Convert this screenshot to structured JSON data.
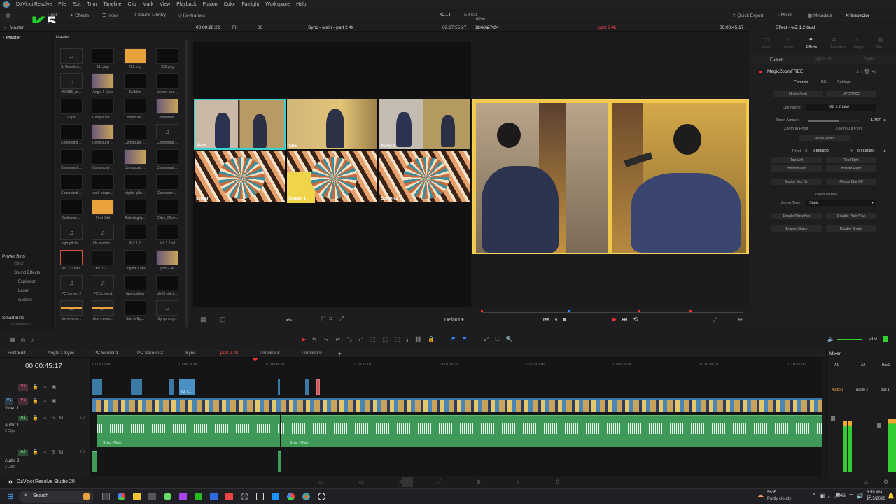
{
  "menu": [
    "DaVinci Resolve",
    "File",
    "Edit",
    "Trim",
    "Timeline",
    "Clip",
    "Mark",
    "View",
    "Playback",
    "Fusion",
    "Color",
    "Fairlight",
    "Workspace",
    "Help"
  ],
  "toolbar": {
    "media_pool": "Pool",
    "effects": "Effects",
    "index": "Index",
    "sound_library": "Sound Library",
    "keyframes": "Keyframes",
    "project": "#2...T",
    "project_status": "Edited",
    "quick_export": "Quick Export",
    "mixer": "Mixer",
    "metadata": "Metadata",
    "inspector": "Inspector"
  },
  "watermark": {
    "letter": "K",
    "number": "5"
  },
  "subbar": {
    "bin": "Master",
    "zoom_fit": "Fit",
    "fps_left": "30",
    "timecode_left": "00:00:28:22",
    "viewer_title": "Sync - Main - part 2 4k",
    "tc_mid": "02:27:55:27",
    "tc_dur": "01:00:57:04",
    "zoom": "62%",
    "fps_right": "30",
    "timeline_name": "part 2 4k",
    "timecode_right": "00:00:45:17"
  },
  "bins": {
    "master": "Master",
    "power_bins": "Power Bins",
    "power_items": [
      "Glitch",
      "Sound Effects",
      "Explosion",
      "Laser",
      "sudden"
    ],
    "smart_bins": "Smart Bins",
    "smart_items": [
      "Collections"
    ]
  },
  "media_clips": [
    "S. Gavattes...",
    "111.png",
    "222.png",
    "333.png",
    "055685_mi...",
    "Angle 1 Sync",
    "Sudden",
    "censor-bee...",
    "Clips",
    "Compound ...",
    "Compound ...",
    "Compound ...",
    "Compound ...",
    "Compound ...",
    "Compound ...",
    "Compound ...",
    "Compound ...",
    "Compound ...",
    "Compound ...",
    "Compound ...",
    "Compound ...",
    "dark-suspe...",
    "digital-glitc...",
    "Explosion ...",
    "Explosion ...",
    "First Edit",
    "flickeringlig...",
    "Glitch_05.m...",
    "high-pitche...",
    "kfs-motivin...",
    "MZ 1.2",
    "MZ 1.2 all",
    "MZ 1.2 talal",
    "MZ 1.2 ...",
    "Original Clips",
    "part 2 4k",
    "PC Screen 2",
    "PC Screen1",
    "fast sudden",
    "sfx20 glitch...",
    "sfx-reverse...",
    "slow-cinem...",
    "Sub in Ep...",
    "Symphony..."
  ],
  "source_tiles": [
    "Main",
    "Talal",
    "Turky 2",
    "screan",
    "Screen 1",
    "Screen 2"
  ],
  "viewer_controls": {
    "default": "Default"
  },
  "inspector": {
    "title": "Effect - MZ 1.2 talal",
    "tabs": [
      "Video",
      "Audio",
      "Effects",
      "Transition",
      "Image",
      "File"
    ],
    "subtabs": [
      "Fusion",
      "Open FX",
      "Audio"
    ],
    "effect_name": "MagicZoomFREE",
    "sections": [
      "Controls",
      "BG",
      "Settings"
    ],
    "btn_row1": [
      "MrAlexTech",
      "UPGRADE"
    ],
    "clip_name_label": "Clip Name",
    "clip_name_value": "MZ 1.2 talal",
    "zoom_amount_label": "Zoom Amount",
    "zoom_amount_value": "1.767",
    "zoom_in_point": "Zoom In Point",
    "zoom_out_point": "Zoom Out Point",
    "reset_points": "Reset Points",
    "pivot_label": "Pivot",
    "pivot_x_label": "X",
    "pivot_x": "0.569829",
    "pivot_y_label": "Y",
    "pivot_y": "0.668089",
    "corners": [
      "Top Left",
      "Top Right",
      "Bottom Left",
      "Bottom Right"
    ],
    "motion_blur": [
      "Motion Blur On",
      "Motion Blur Off"
    ],
    "zoom_details": "Zoom Details",
    "zoom_type_label": "Zoom Type",
    "zoom_type_value": "Static",
    "pitch_yaw": [
      "Enable Pitch/Yaw",
      "Disable Pitch/Yaw"
    ],
    "shake": [
      "Enable Shake",
      "Disable Shake"
    ]
  },
  "timeline": {
    "tabs": [
      "First Edit",
      "Angle 1 Sync",
      "PC Screen1",
      "PC Screen 2",
      "Sync",
      "part 2 4k",
      "Timeline 8",
      "Timeline 9"
    ],
    "active_tab": "part 2 4k",
    "timecode": "00:00:45:17",
    "ruler": [
      "01:00:00:00",
      "01:00:24:00",
      "01:00:48:00",
      "01:01:12:00",
      "01:01:36:00",
      "01:02:00:00",
      "01:02:24:00",
      "01:02:48:00",
      "01:03:12:00"
    ],
    "tracks": [
      {
        "id": "V2",
        "name": ""
      },
      {
        "id": "V1",
        "name": "Video 1"
      },
      {
        "id": "A1",
        "name": "Audio 1",
        "clips": "3 Clips",
        "level": "2.0"
      },
      {
        "id": "A2",
        "name": "Audio 2",
        "clips": "3 Clips",
        "level": "2.0"
      }
    ],
    "clip_labels": {
      "mz": "MZ 1...",
      "audio1": "Sync - Main",
      "audio2": "Sync - Main"
    }
  },
  "mixer": {
    "title": "Mixer",
    "channels": [
      "A1",
      "A2",
      "Bus1"
    ],
    "names": [
      "Audio 1",
      "Audio 2",
      "Bus 1"
    ],
    "dim": "DIM"
  },
  "footer": {
    "app": "DaVinci Resolve Studio 20"
  },
  "taskbar": {
    "search": "Search",
    "weather_temp": "56°F",
    "weather_desc": "Partly cloudy",
    "lang": "ENG",
    "time": "3:59 AM",
    "date": "1/15/2026"
  }
}
